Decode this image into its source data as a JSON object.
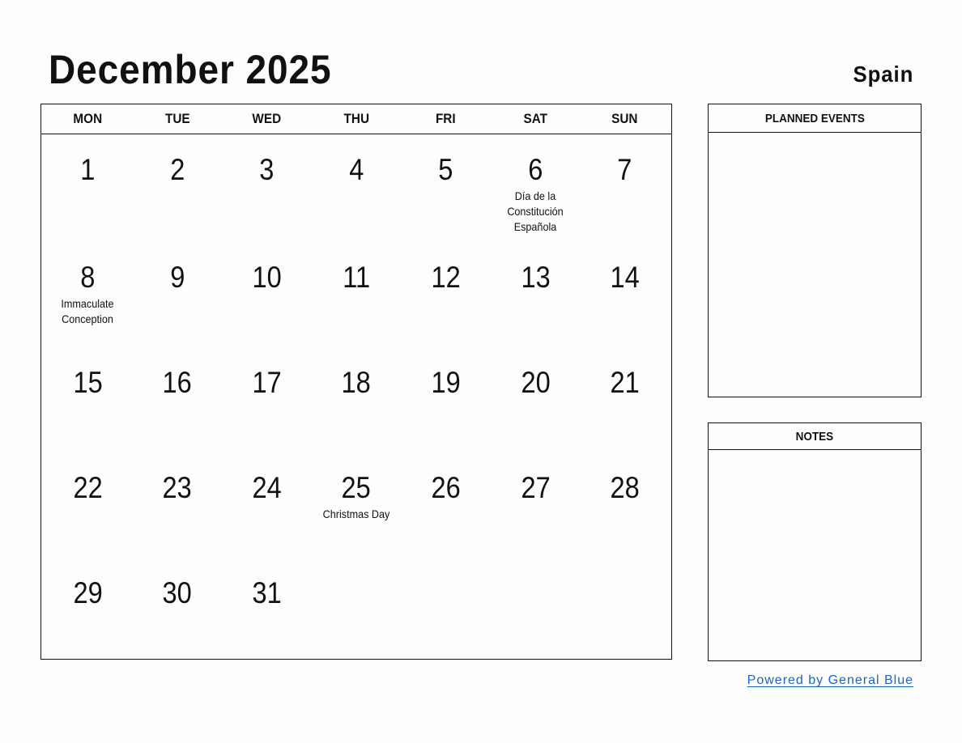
{
  "header": {
    "title": "December 2025",
    "country": "Spain"
  },
  "calendar": {
    "weekdays": [
      "MON",
      "TUE",
      "WED",
      "THU",
      "FRI",
      "SAT",
      "SUN"
    ],
    "weeks": [
      [
        {
          "day": "1",
          "holiday": ""
        },
        {
          "day": "2",
          "holiday": ""
        },
        {
          "day": "3",
          "holiday": ""
        },
        {
          "day": "4",
          "holiday": ""
        },
        {
          "day": "5",
          "holiday": ""
        },
        {
          "day": "6",
          "holiday": "Día de la Constitución Española"
        },
        {
          "day": "7",
          "holiday": ""
        }
      ],
      [
        {
          "day": "8",
          "holiday": "Immaculate Conception"
        },
        {
          "day": "9",
          "holiday": ""
        },
        {
          "day": "10",
          "holiday": ""
        },
        {
          "day": "11",
          "holiday": ""
        },
        {
          "day": "12",
          "holiday": ""
        },
        {
          "day": "13",
          "holiday": ""
        },
        {
          "day": "14",
          "holiday": ""
        }
      ],
      [
        {
          "day": "15",
          "holiday": ""
        },
        {
          "day": "16",
          "holiday": ""
        },
        {
          "day": "17",
          "holiday": ""
        },
        {
          "day": "18",
          "holiday": ""
        },
        {
          "day": "19",
          "holiday": ""
        },
        {
          "day": "20",
          "holiday": ""
        },
        {
          "day": "21",
          "holiday": ""
        }
      ],
      [
        {
          "day": "22",
          "holiday": ""
        },
        {
          "day": "23",
          "holiday": ""
        },
        {
          "day": "24",
          "holiday": ""
        },
        {
          "day": "25",
          "holiday": "Christmas Day"
        },
        {
          "day": "26",
          "holiday": ""
        },
        {
          "day": "27",
          "holiday": ""
        },
        {
          "day": "28",
          "holiday": ""
        }
      ],
      [
        {
          "day": "29",
          "holiday": ""
        },
        {
          "day": "30",
          "holiday": ""
        },
        {
          "day": "31",
          "holiday": ""
        },
        {
          "day": "",
          "holiday": ""
        },
        {
          "day": "",
          "holiday": ""
        },
        {
          "day": "",
          "holiday": ""
        },
        {
          "day": "",
          "holiday": ""
        }
      ]
    ]
  },
  "panels": {
    "planned_events": {
      "title": "PLANNED EVENTS"
    },
    "notes": {
      "title": "NOTES"
    }
  },
  "footer": {
    "powered_by": "Powered by General Blue",
    "link_color": "#1a66c2"
  }
}
